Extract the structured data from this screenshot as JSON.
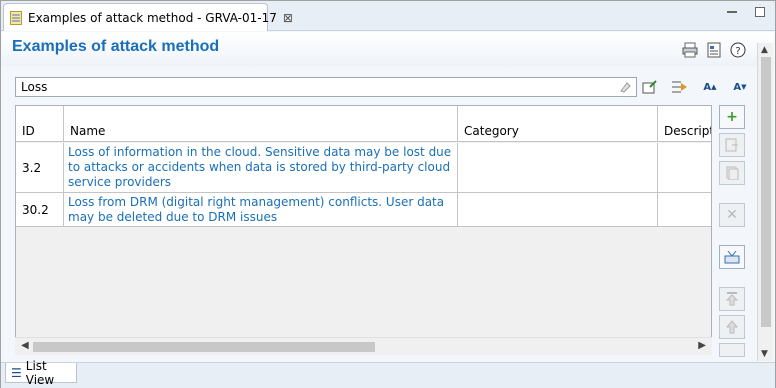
{
  "editor_tab": {
    "title": "Examples of attack method - GRVA-01-17",
    "close": "⊠",
    "icon": "document-icon"
  },
  "form": {
    "title": "Examples of attack method"
  },
  "header_icons": [
    "print-icon",
    "export-icon",
    "help-icon"
  ],
  "filter": {
    "value": "Loss"
  },
  "tools": {
    "increase_font": "A",
    "decrease_font": "A"
  },
  "table": {
    "columns": [
      "ID",
      "Name",
      "Category",
      "Descriptio"
    ],
    "rows": [
      {
        "id": "3.2",
        "name": "Loss of information in the cloud. Sensitive data may be lost due to attacks or accidents when data is stored by third-party cloud service providers",
        "category": "",
        "description": ""
      },
      {
        "id": "30.2",
        "name": "Loss from DRM (digital right management) conflicts. User data may be deleted due to DRM issues",
        "category": "",
        "description": ""
      }
    ]
  },
  "side_buttons": {
    "add": "+",
    "delete": "✕"
  },
  "bottom_tab": {
    "label": "List View",
    "icon": "list-icon"
  },
  "colors": {
    "accent": "#1a6fb8",
    "link": "#1a6fb8",
    "add_green": "#3c9a2e"
  }
}
